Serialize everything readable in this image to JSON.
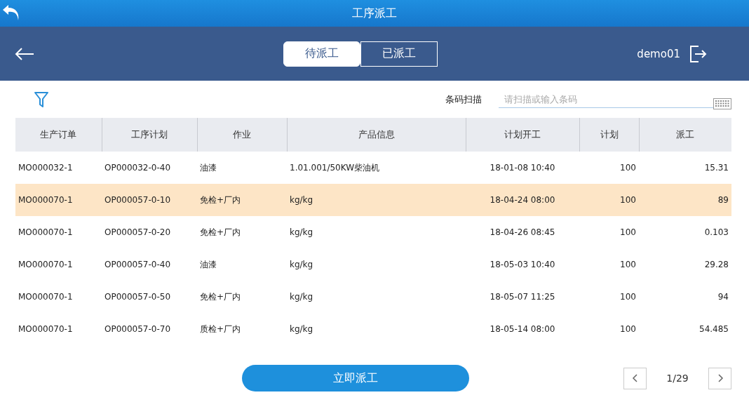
{
  "window": {
    "title": "工序派工"
  },
  "header": {
    "user": "demo01"
  },
  "tabs": [
    {
      "label": "待派工",
      "selected": true
    },
    {
      "label": "已派工",
      "selected": false
    }
  ],
  "barcode": {
    "label": "条码扫描",
    "placeholder": "请扫描或输入条码"
  },
  "table": {
    "columns": [
      "生产订单",
      "工序计划",
      "作业",
      "产品信息",
      "计划开工",
      "计划",
      "派工"
    ],
    "rows": [
      {
        "cells": [
          "MO000032-1",
          "OP000032-0-40",
          "油漆",
          "1.01.001/50KW柴油机",
          "18-01-08 10:40",
          "100",
          "15.31"
        ],
        "selected": false
      },
      {
        "cells": [
          "MO000070-1",
          "OP000057-0-10",
          "免检+厂内",
          "kg/kg",
          "18-04-24 08:00",
          "100",
          "89"
        ],
        "selected": true
      },
      {
        "cells": [
          "MO000070-1",
          "OP000057-0-20",
          "免检+厂内",
          "kg/kg",
          "18-04-26 08:45",
          "100",
          "0.103"
        ],
        "selected": false
      },
      {
        "cells": [
          "MO000070-1",
          "OP000057-0-40",
          "油漆",
          "kg/kg",
          "18-05-03 10:40",
          "100",
          "29.28"
        ],
        "selected": false
      },
      {
        "cells": [
          "MO000070-1",
          "OP000057-0-50",
          "免检+厂内",
          "kg/kg",
          "18-05-07 11:25",
          "100",
          "94"
        ],
        "selected": false
      },
      {
        "cells": [
          "MO000070-1",
          "OP000057-0-70",
          "质检+厂内",
          "kg/kg",
          "18-05-14 08:00",
          "100",
          "54.485"
        ],
        "selected": false
      }
    ]
  },
  "dispatch_button": "立即派工",
  "pagination": {
    "page": "1/29"
  }
}
